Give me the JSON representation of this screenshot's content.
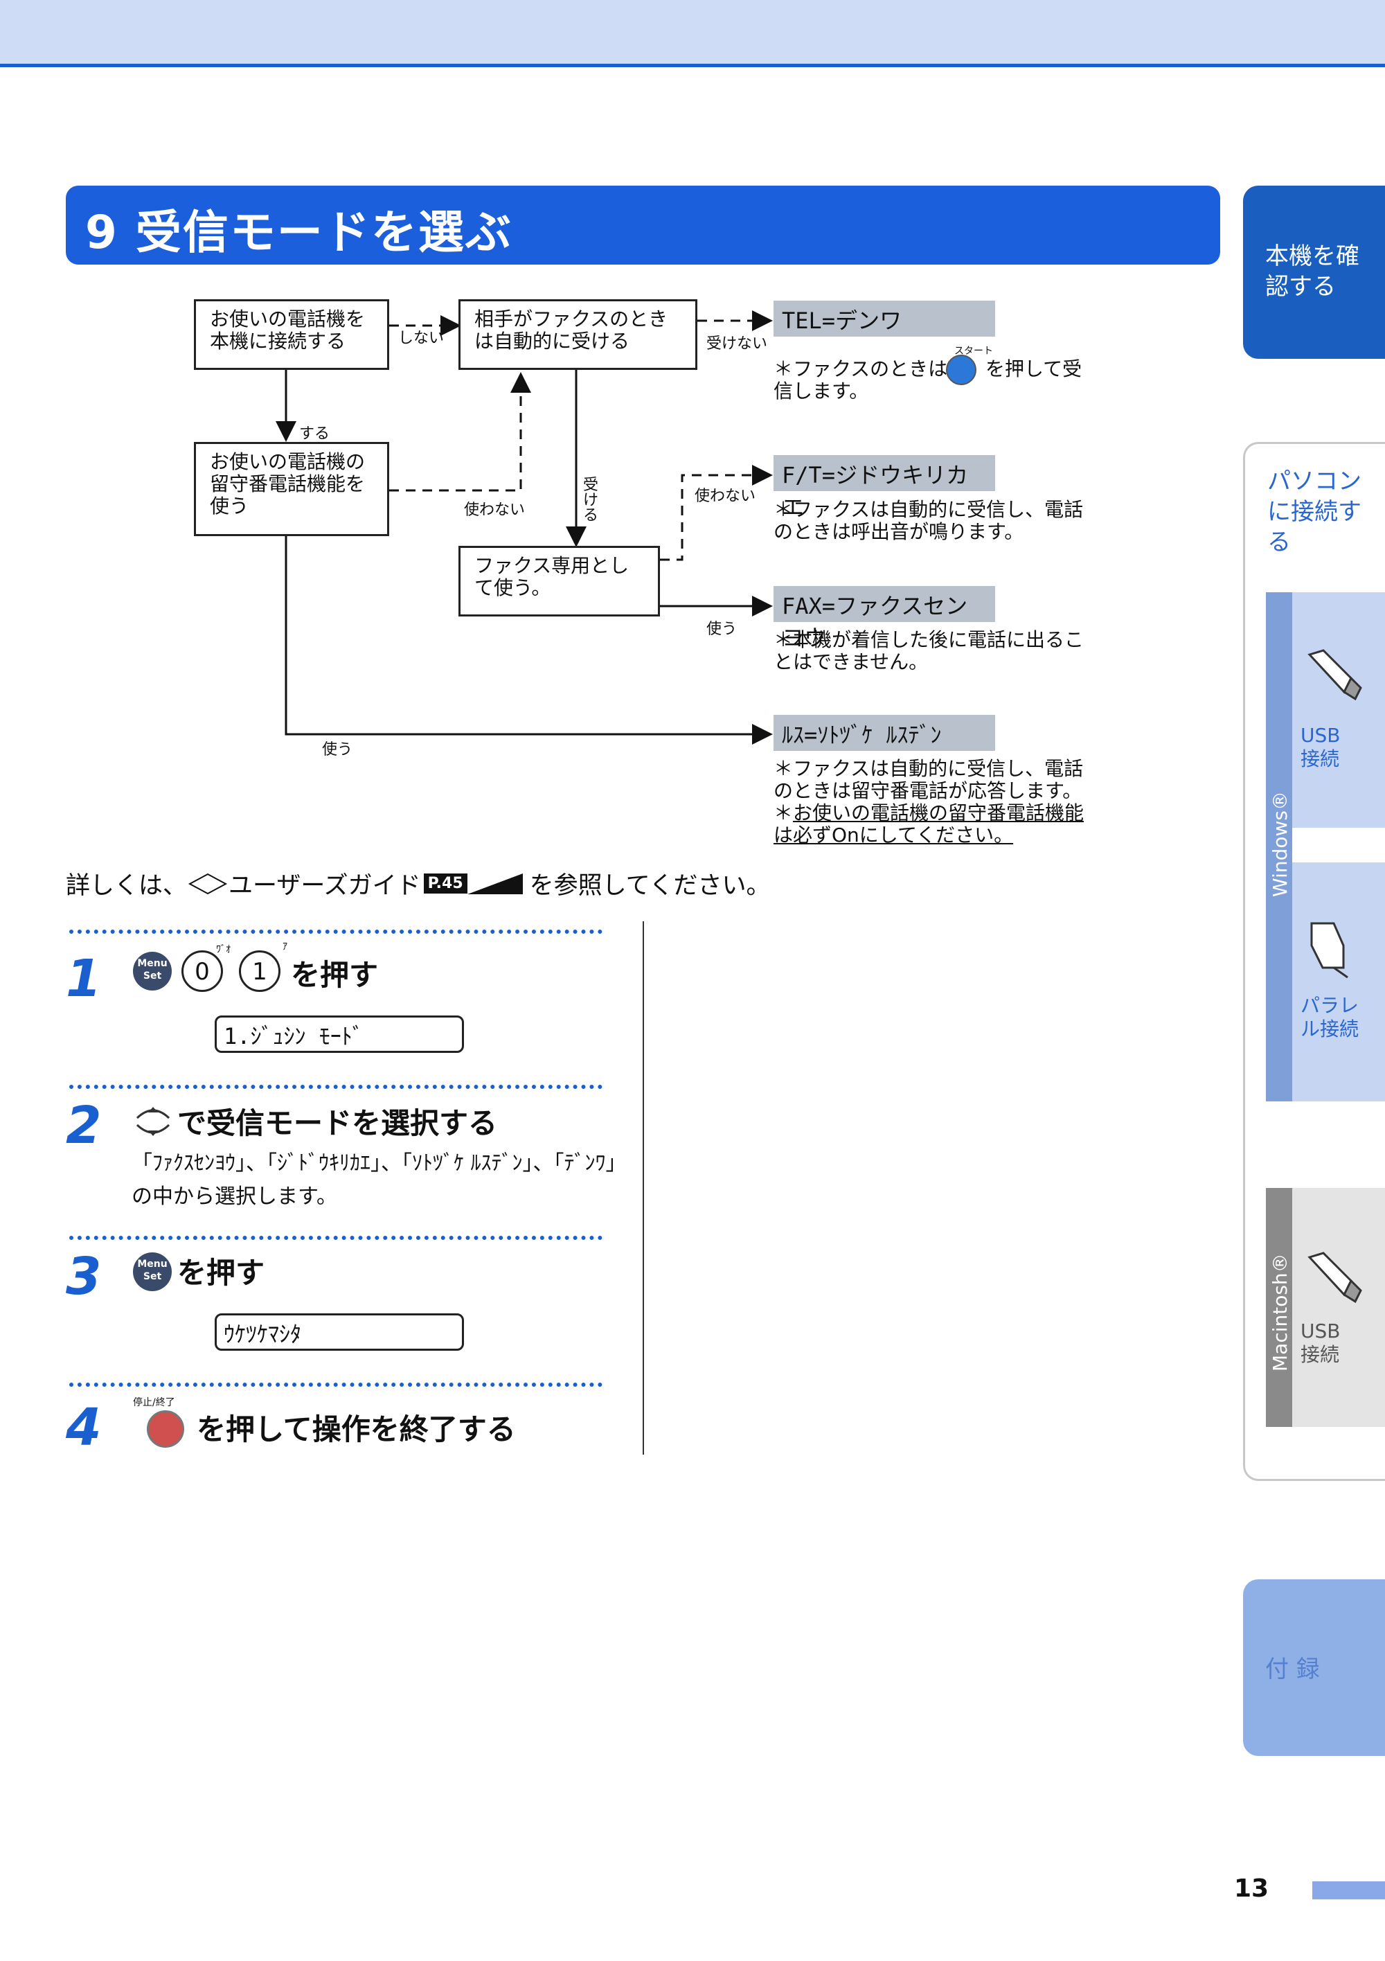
{
  "section": {
    "title": "9 受信モードを選ぶ"
  },
  "flow": {
    "box_connect": "お使いの電話機を本機に接続する",
    "box_fax_auto": "相手がファクスのときは自動的に受ける",
    "box_answering": "お使いの電話機の留守番電話機能を使う",
    "box_fax_only": "ファクス専用として使う。",
    "label_shinai": "しない",
    "label_suru": "する",
    "label_ukenai": "受けない",
    "label_ukeru": "受ける",
    "label_tsukawanai_1": "使わない",
    "label_tsukawanai_2": "使わない",
    "label_tsukau_1": "使う",
    "label_tsukau_2": "使う",
    "mode_tel": "TEL=デンワ",
    "mode_ft": "F/T=ジドウキリカエ",
    "mode_fax": "FAX=ファクスセンヨウ",
    "mode_rusu": "ﾙｽ=ｿﾄﾂﾞｹ ﾙｽﾃﾞﾝ",
    "note_tel_a": "＊ファクスのときは",
    "note_tel_b": "を押して受信します。",
    "start_label": "スタート",
    "note_ft": "＊ファクスは自動的に受信し、電話のときは呼出音が鳴ります。",
    "note_fax": "＊本機が着信した後に電話に出ることはできません。",
    "note_rusu_1": "＊ファクスは自動的に受信し、電話のときは留守番電話が応答します。",
    "note_rusu_2": "お使いの電話機の留守番電話機能は必ずOnにしてください。"
  },
  "reference": {
    "prefix": "詳しくは、",
    "guide": "ユーザーズガイド",
    "page": "P.45",
    "suffix": "を参照してください。"
  },
  "steps": [
    {
      "num": "1",
      "text": "を押す",
      "lcd": "1.ｼﾞｭｼﾝ ﾓｰﾄﾞ",
      "key0": "0",
      "key1": "1",
      "key0_sub": "ﾜﾞｵ",
      "key1_sub": "ｱ"
    },
    {
      "num": "2",
      "text": "で受信モードを選択する",
      "desc1": "「ﾌｧｸｽｾﾝﾖｳ」、「ｼﾞﾄﾞｳｷﾘｶｴ」、「ｿﾄﾂﾞｹ ﾙｽﾃﾞﾝ」、「ﾃﾞﾝﾜ」",
      "desc2": "の中から選択します。"
    },
    {
      "num": "3",
      "text": "を押す",
      "lcd": "ｳｹﾂｹﾏｼﾀ"
    },
    {
      "num": "4",
      "text": "を押して操作を終了する",
      "stop_label": "停止/終了"
    }
  ],
  "menu_key": {
    "line1": "Menu",
    "line2": "Set"
  },
  "tabs": {
    "confirm": "本機を確認する",
    "pc": "パソコンに接続する",
    "windows": "Windows®",
    "usb_win": "USB接続",
    "parallel": "パラレル接続",
    "mac": "Macintosh®",
    "usb_mac": "USB接続",
    "appendix": "付 録"
  },
  "page_number": "13",
  "colors": {
    "accent": "#1c5fdd",
    "top_band": "#cfdcf6",
    "mode_box": "#b9c2cc"
  }
}
